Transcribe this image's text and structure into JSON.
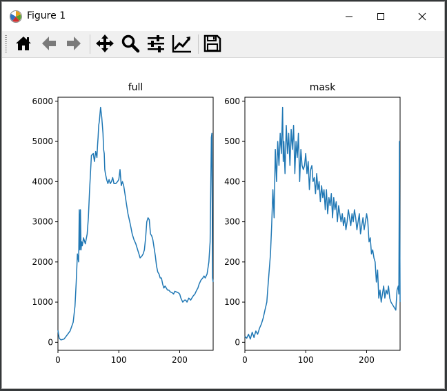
{
  "window": {
    "title": "Figure 1",
    "minimize_icon": "minimize-icon",
    "maximize_icon": "maximize-icon",
    "close_icon": "close-icon"
  },
  "toolbar": {
    "items": [
      {
        "name": "home-icon"
      },
      {
        "name": "back-arrow-icon"
      },
      {
        "name": "forward-arrow-icon"
      },
      {
        "name": "pan-icon"
      },
      {
        "name": "zoom-icon"
      },
      {
        "name": "configure-subplots-icon"
      },
      {
        "name": "edit-axis-icon"
      },
      {
        "name": "save-icon"
      }
    ]
  },
  "colors": {
    "line": "#1f77b4",
    "axis": "#000000"
  },
  "chart_data": [
    {
      "type": "line",
      "title": "full",
      "xlim": [
        0,
        255
      ],
      "ylim": [
        -200,
        6100
      ],
      "xticks": [
        0,
        100,
        200
      ],
      "yticks": [
        0,
        1000,
        2000,
        3000,
        4000,
        5000,
        6000
      ],
      "x": [
        0,
        2,
        5,
        10,
        15,
        20,
        25,
        28,
        30,
        32,
        34,
        35,
        36,
        37,
        38,
        39,
        40,
        42,
        45,
        48,
        50,
        52,
        55,
        58,
        60,
        62,
        64,
        65,
        66,
        67,
        68,
        70,
        72,
        74,
        75,
        76,
        77,
        78,
        80,
        82,
        84,
        86,
        88,
        90,
        92,
        95,
        98,
        100,
        102,
        104,
        106,
        108,
        110,
        112,
        115,
        118,
        120,
        122,
        125,
        128,
        130,
        133,
        135,
        138,
        140,
        142,
        144,
        146,
        148,
        150,
        152,
        154,
        155,
        156,
        157,
        158,
        160,
        162,
        164,
        166,
        168,
        170,
        172,
        174,
        176,
        178,
        180,
        182,
        185,
        188,
        190,
        192,
        195,
        198,
        200,
        202,
        205,
        208,
        210,
        212,
        215,
        218,
        220,
        222,
        225,
        228,
        230,
        232,
        235,
        238,
        240,
        242,
        245,
        248,
        250,
        252,
        253,
        254,
        255
      ],
      "y": [
        300,
        100,
        60,
        80,
        180,
        280,
        500,
        900,
        1500,
        2200,
        2000,
        3300,
        2300,
        3300,
        2300,
        2500,
        2400,
        2600,
        2450,
        2700,
        3100,
        3800,
        4650,
        4700,
        4500,
        4750,
        4600,
        4900,
        5100,
        5400,
        5500,
        5850,
        5600,
        5200,
        4800,
        4700,
        4300,
        4200,
        4050,
        3950,
        4050,
        3950,
        4000,
        4100,
        3950,
        3950,
        4000,
        4050,
        4300,
        3900,
        4000,
        3900,
        3700,
        3500,
        3200,
        3000,
        2850,
        2700,
        2550,
        2450,
        2350,
        2200,
        2100,
        2150,
        2200,
        2300,
        2600,
        3000,
        3100,
        3050,
        2700,
        2650,
        2600,
        2550,
        2450,
        2350,
        2150,
        1900,
        1750,
        1700,
        1600,
        1600,
        1450,
        1350,
        1400,
        1350,
        1300,
        1300,
        1250,
        1230,
        1200,
        1270,
        1250,
        1230,
        1200,
        1100,
        1000,
        1050,
        1050,
        1000,
        1100,
        1050,
        1100,
        1150,
        1200,
        1300,
        1350,
        1450,
        1550,
        1600,
        1650,
        1600,
        1700,
        2000,
        2500,
        5100,
        5200,
        1600,
        1500
      ]
    },
    {
      "type": "line",
      "title": "mask",
      "xlim": [
        0,
        255
      ],
      "ylim": [
        -20,
        610
      ],
      "xticks": [
        0,
        100,
        200
      ],
      "yticks": [
        0,
        100,
        200,
        300,
        400,
        500,
        600
      ],
      "x": [
        0,
        3,
        6,
        9,
        12,
        15,
        18,
        21,
        24,
        27,
        30,
        33,
        36,
        38,
        40,
        42,
        44,
        46,
        48,
        50,
        52,
        54,
        56,
        58,
        60,
        62,
        63,
        64,
        66,
        68,
        70,
        72,
        74,
        76,
        78,
        80,
        82,
        84,
        86,
        88,
        90,
        92,
        94,
        96,
        98,
        100,
        102,
        104,
        106,
        108,
        110,
        112,
        114,
        116,
        118,
        120,
        122,
        124,
        126,
        128,
        130,
        132,
        134,
        136,
        138,
        140,
        142,
        144,
        146,
        148,
        150,
        152,
        154,
        156,
        158,
        160,
        162,
        164,
        166,
        168,
        170,
        172,
        174,
        176,
        178,
        180,
        182,
        184,
        186,
        188,
        190,
        192,
        194,
        196,
        198,
        200,
        202,
        204,
        206,
        208,
        210,
        212,
        214,
        216,
        218,
        220,
        222,
        224,
        226,
        228,
        230,
        232,
        234,
        236,
        238,
        240,
        242,
        244,
        246,
        248,
        250,
        252,
        253,
        254,
        255
      ],
      "y": [
        15,
        10,
        20,
        8,
        25,
        12,
        28,
        20,
        35,
        45,
        60,
        80,
        100,
        140,
        180,
        220,
        290,
        380,
        310,
        480,
        400,
        500,
        440,
        520,
        470,
        585,
        450,
        500,
        420,
        540,
        470,
        520,
        440,
        530,
        480,
        540,
        420,
        500,
        460,
        520,
        400,
        480,
        440,
        430,
        440,
        470,
        420,
        450,
        380,
        430,
        440,
        400,
        410,
        370,
        420,
        380,
        400,
        350,
        390,
        360,
        380,
        330,
        380,
        320,
        360,
        340,
        370,
        310,
        360,
        330,
        350,
        300,
        340,
        320,
        300,
        320,
        290,
        310,
        280,
        300,
        330,
        310,
        290,
        320,
        300,
        330,
        310,
        280,
        300,
        320,
        270,
        290,
        310,
        280,
        300,
        320,
        300,
        250,
        260,
        220,
        230,
        210,
        200,
        150,
        180,
        110,
        130,
        100,
        120,
        140,
        110,
        130,
        120,
        140,
        110,
        100,
        95,
        90,
        85,
        80,
        130,
        140,
        120,
        500,
        100
      ]
    }
  ]
}
